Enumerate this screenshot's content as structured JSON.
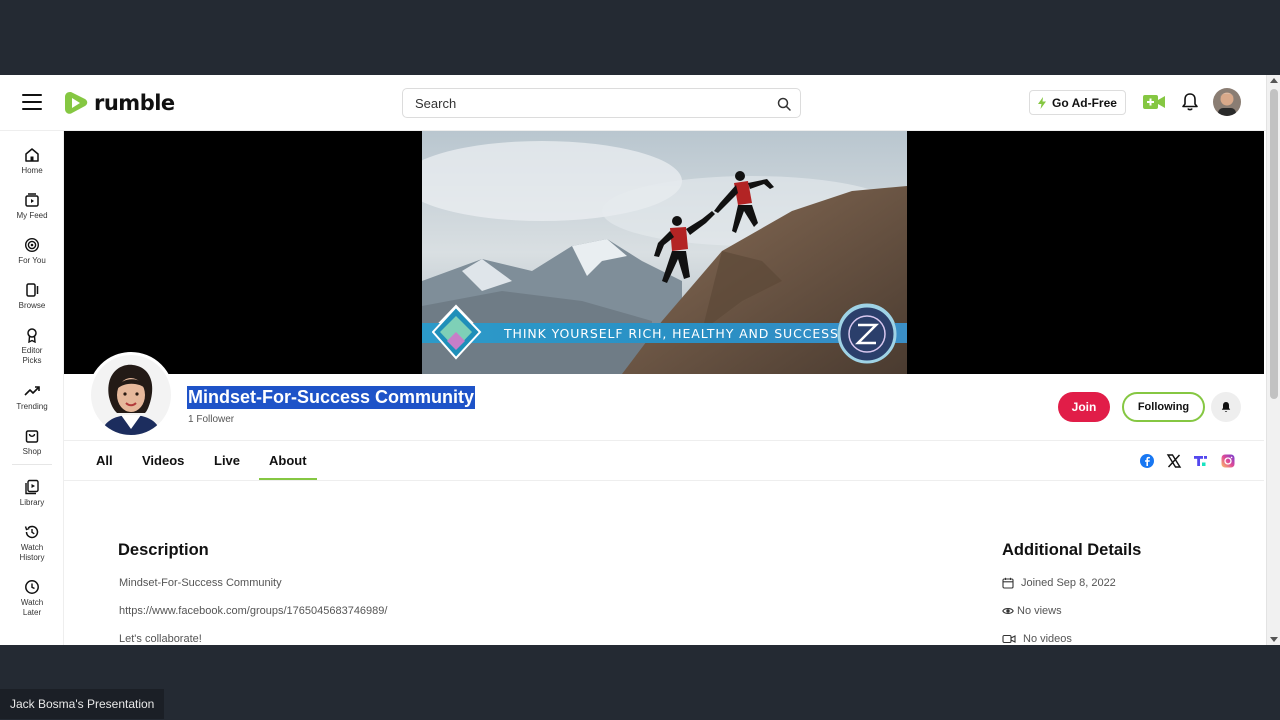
{
  "header": {
    "logo_text": "rumble",
    "search_placeholder": "Search",
    "go_ad_free": "Go Ad-Free"
  },
  "sidebar": {
    "items": [
      {
        "label": "Home",
        "icon": "home-icon"
      },
      {
        "label": "My Feed",
        "icon": "feed-icon"
      },
      {
        "label": "For You",
        "icon": "target-icon"
      },
      {
        "label": "Browse",
        "icon": "browse-icon"
      },
      {
        "label": "Editor Picks",
        "icon": "award-icon"
      },
      {
        "label": "Trending",
        "icon": "trending-icon"
      },
      {
        "label": "Shop",
        "icon": "shop-icon"
      },
      {
        "label": "Library",
        "icon": "library-icon"
      },
      {
        "label": "Watch History",
        "icon": "history-icon"
      },
      {
        "label": "Watch Later",
        "icon": "clock-icon"
      }
    ]
  },
  "banner": {
    "tagline": "THINK YOURSELF RICH, HEALTHY AND SUCCESSFUL!"
  },
  "channel": {
    "name": "Mindset-For-Success Community",
    "followers": "1 Follower",
    "join_label": "Join",
    "following_label": "Following"
  },
  "tabs": [
    {
      "label": "All"
    },
    {
      "label": "Videos"
    },
    {
      "label": "Live"
    },
    {
      "label": "About",
      "active": true
    }
  ],
  "about": {
    "description_heading": "Description",
    "description_lines": [
      "Mindset-For-Success Community",
      "https://www.facebook.com/groups/1765045683746989/",
      "Let's collaborate!"
    ],
    "details_heading": "Additional Details",
    "details": [
      {
        "icon": "calendar-icon",
        "text": "Joined Sep 8, 2022"
      },
      {
        "icon": "eye-icon",
        "text": "No views"
      },
      {
        "icon": "video-icon",
        "text": "No videos"
      }
    ]
  },
  "social_links": [
    "facebook-icon",
    "x-icon",
    "truth-social-icon",
    "instagram-icon"
  ],
  "presentation_caption": "Jack Bosma's Presentation",
  "colors": {
    "accent_green": "#85c742",
    "join_red": "#e11d48",
    "selection_blue": "#1e53c8",
    "background_dark": "#242a33"
  }
}
